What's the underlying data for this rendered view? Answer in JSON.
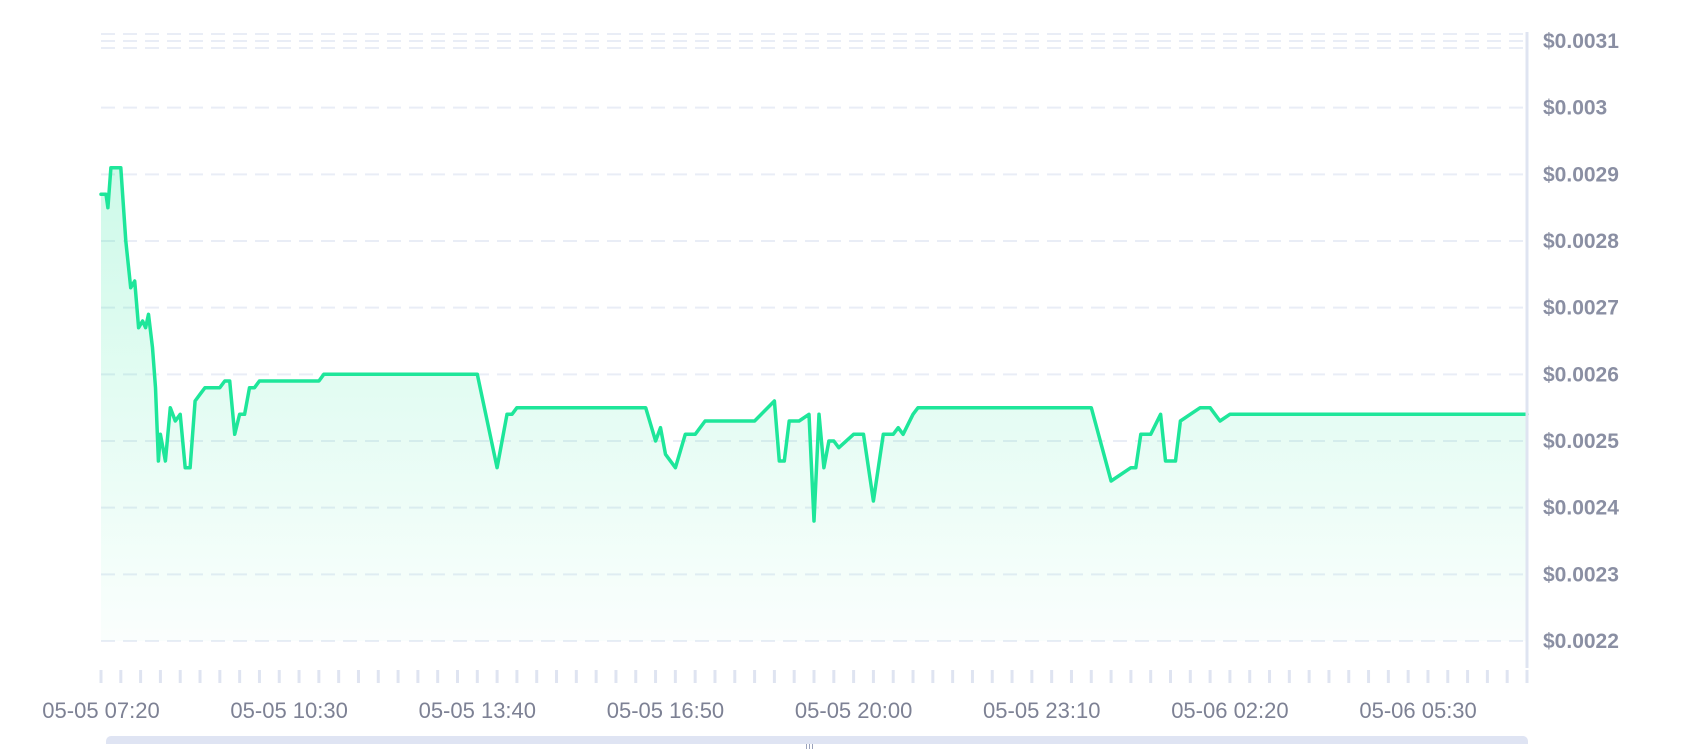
{
  "colors": {
    "line": "#1ee69a",
    "fill_top": "#1ee69a",
    "grid": "#e9edf6",
    "axis": "#dfe4f1",
    "tick_text": "#8a8fa3",
    "scrollbar": "#dfe4f3"
  },
  "chart_data": {
    "type": "area",
    "title": "",
    "xlabel": "",
    "ylabel": "",
    "y_axis_position": "right",
    "grid": "horizontal dashed",
    "ylim": [
      0.0022,
      0.0031
    ],
    "xlim": [
      "05-05 07:20",
      "05-06 07:20"
    ],
    "y_ticks": [
      "$0.0031",
      "$0.003",
      "$0.0029",
      "$0.0028",
      "$0.0027",
      "$0.0026",
      "$0.0025",
      "$0.0024",
      "$0.0023",
      "$0.0022"
    ],
    "y_tick_values": [
      0.0031,
      0.003,
      0.0029,
      0.0028,
      0.0027,
      0.0026,
      0.0025,
      0.0024,
      0.0023,
      0.0022
    ],
    "x_ticks": [
      "05-05 07:20",
      "05-05 10:30",
      "05-05 13:40",
      "05-05 16:50",
      "05-05 20:00",
      "05-05 23:10",
      "05-06 02:20",
      "05-06 05:30"
    ],
    "x_tick_interval": "20 min",
    "series": [
      {
        "x": [
          "05-05 07:20",
          "05-05 07:25",
          "05-05 07:27",
          "05-05 07:30",
          "05-05 07:35",
          "05-05 07:40",
          "05-05 07:45",
          "05-05 07:50",
          "05-05 07:54",
          "05-05 07:58",
          "05-05 08:02",
          "05-05 08:05",
          "05-05 08:08",
          "05-05 08:12",
          "05-05 08:15",
          "05-05 08:18",
          "05-05 08:20",
          "05-05 08:25",
          "05-05 08:30",
          "05-05 08:35",
          "05-05 08:40",
          "05-05 08:45",
          "05-05 08:50",
          "05-05 08:55",
          "05-05 09:00",
          "05-05 09:05",
          "05-05 09:10",
          "05-05 09:15",
          "05-05 09:20",
          "05-05 09:25",
          "05-05 09:30",
          "05-05 09:35",
          "05-05 09:40",
          "05-05 09:45",
          "05-05 09:50",
          "05-05 09:55",
          "05-05 10:00",
          "05-05 10:10",
          "05-05 10:20",
          "05-05 10:30",
          "05-05 10:40",
          "05-05 10:45",
          "05-05 10:50",
          "05-05 11:00",
          "05-05 11:05",
          "05-05 11:10",
          "05-05 11:15",
          "05-05 11:20",
          "05-05 11:30",
          "05-05 11:40",
          "05-05 12:00",
          "05-05 12:20",
          "05-05 12:40",
          "05-05 13:00",
          "05-05 13:20",
          "05-05 13:40",
          "05-05 14:00",
          "05-05 14:10",
          "05-05 14:15",
          "05-05 14:20",
          "05-05 14:25",
          "05-05 14:40",
          "05-05 15:00",
          "05-05 15:30",
          "05-05 16:00",
          "05-05 16:30",
          "05-05 16:40",
          "05-05 16:45",
          "05-05 16:50",
          "05-05 17:00",
          "05-05 17:10",
          "05-05 17:20",
          "05-05 17:30",
          "05-05 17:40",
          "05-05 18:00",
          "05-05 18:20",
          "05-05 18:40",
          "05-05 18:45",
          "05-05 18:50",
          "05-05 18:55",
          "05-05 19:05",
          "05-05 19:15",
          "05-05 19:20",
          "05-05 19:25",
          "05-05 19:30",
          "05-05 19:35",
          "05-05 19:40",
          "05-05 19:45",
          "05-05 20:00",
          "05-05 20:10",
          "05-05 20:20",
          "05-05 20:30",
          "05-05 20:40",
          "05-05 20:45",
          "05-05 20:50",
          "05-05 21:00",
          "05-05 21:05",
          "05-05 21:10",
          "05-05 21:20",
          "05-05 21:30",
          "05-05 21:40",
          "05-05 22:00",
          "05-05 22:30",
          "05-05 23:00",
          "05-05 23:30",
          "05-06 00:00",
          "05-06 00:20",
          "05-06 00:40",
          "05-06 00:45",
          "05-06 00:50",
          "05-06 01:00",
          "05-06 01:10",
          "05-06 01:15",
          "05-06 01:25",
          "05-06 01:30",
          "05-06 01:40",
          "05-06 01:50",
          "05-06 02:00",
          "05-06 02:10",
          "05-06 02:20",
          "05-06 02:30",
          "05-06 02:40",
          "05-06 03:00",
          "05-06 03:20",
          "05-06 03:40",
          "05-06 04:00",
          "05-06 04:20",
          "05-06 04:40",
          "05-06 05:00",
          "05-06 05:30",
          "05-06 06:00",
          "05-06 06:30",
          "05-06 07:00",
          "05-06 07:20"
        ],
        "values": [
          0.00287,
          0.00287,
          0.00285,
          0.00291,
          0.00291,
          0.00291,
          0.0028,
          0.00273,
          0.00274,
          0.00267,
          0.00268,
          0.00267,
          0.00269,
          0.00264,
          0.00258,
          0.00247,
          0.00251,
          0.00247,
          0.00255,
          0.00253,
          0.00254,
          0.00246,
          0.00246,
          0.00256,
          0.00257,
          0.00258,
          0.00258,
          0.00258,
          0.00258,
          0.00259,
          0.00259,
          0.00251,
          0.00254,
          0.00254,
          0.00258,
          0.00258,
          0.00259,
          0.00259,
          0.00259,
          0.00259,
          0.00259,
          0.00259,
          0.00259,
          0.00259,
          0.0026,
          0.0026,
          0.0026,
          0.0026,
          0.0026,
          0.0026,
          0.0026,
          0.0026,
          0.0026,
          0.0026,
          0.0026,
          0.0026,
          0.00246,
          0.00254,
          0.00254,
          0.00255,
          0.00255,
          0.00255,
          0.00255,
          0.00255,
          0.00255,
          0.00255,
          0.0025,
          0.00252,
          0.00248,
          0.00246,
          0.00251,
          0.00251,
          0.00253,
          0.00253,
          0.00253,
          0.00253,
          0.00256,
          0.00247,
          0.00247,
          0.00253,
          0.00253,
          0.00254,
          0.00238,
          0.00254,
          0.00246,
          0.0025,
          0.0025,
          0.00249,
          0.00251,
          0.00251,
          0.00241,
          0.00251,
          0.00251,
          0.00252,
          0.00251,
          0.00254,
          0.00255,
          0.00255,
          0.00255,
          0.00255,
          0.00255,
          0.00255,
          0.00255,
          0.00255,
          0.00255,
          0.00255,
          0.00244,
          0.00246,
          0.00246,
          0.00251,
          0.00251,
          0.00254,
          0.00247,
          0.00247,
          0.00253,
          0.00254,
          0.00255,
          0.00255,
          0.00253,
          0.00254,
          0.00254,
          0.00254,
          0.00254,
          0.00254,
          0.00254,
          0.00254,
          0.00254,
          0.00254,
          0.00254,
          0.00254,
          0.00254,
          0.00254,
          0.00254,
          0.00254
        ]
      }
    ]
  }
}
